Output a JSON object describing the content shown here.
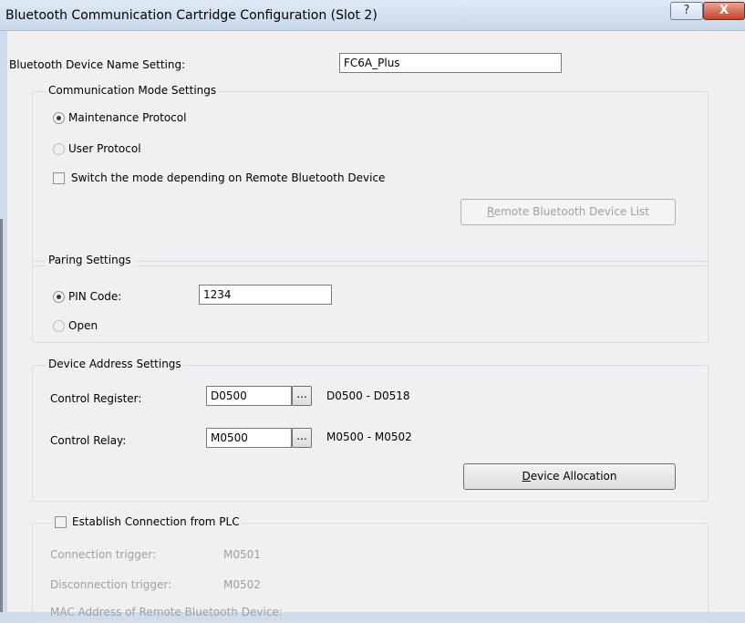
{
  "window": {
    "title": "Bluetooth Communication Cartridge Configuration (Slot 2)",
    "help_glyph": "?",
    "close_glyph": "X"
  },
  "device_name": {
    "label": "Bluetooth Device Name Setting:",
    "value": "FC6A_Plus"
  },
  "comm_mode": {
    "title": "Communication Mode Settings",
    "maintenance_label": "Maintenance Protocol",
    "user_label": "User Protocol",
    "switch_label": "Switch the mode depending on Remote Bluetooth Device",
    "remote_list_button": {
      "accel": "R",
      "rest": "emote Bluetooth Device List"
    }
  },
  "pairing": {
    "title": "Paring Settings",
    "pin_label": "PIN Code:",
    "pin_value": "1234",
    "open_label": "Open"
  },
  "device_address": {
    "title": "Device Address Settings",
    "control_register_label": "Control Register:",
    "control_register_value": "D0500",
    "control_register_range": "D0500 - D0518",
    "control_relay_label": "Control Relay:",
    "control_relay_value": "M0500",
    "control_relay_range": "M0500 - M0502",
    "ellipsis": "...",
    "device_allocation_button": {
      "accel": "D",
      "rest": "evice Allocation"
    }
  },
  "establish": {
    "title": "Establish Connection from PLC",
    "connection_trigger_label": "Connection trigger:",
    "connection_trigger_value": "M0501",
    "disconnection_trigger_label": "Disconnection trigger:",
    "disconnection_trigger_value": "M0502",
    "mac_label": "MAC Address of Remote Bluetooth Device:"
  }
}
